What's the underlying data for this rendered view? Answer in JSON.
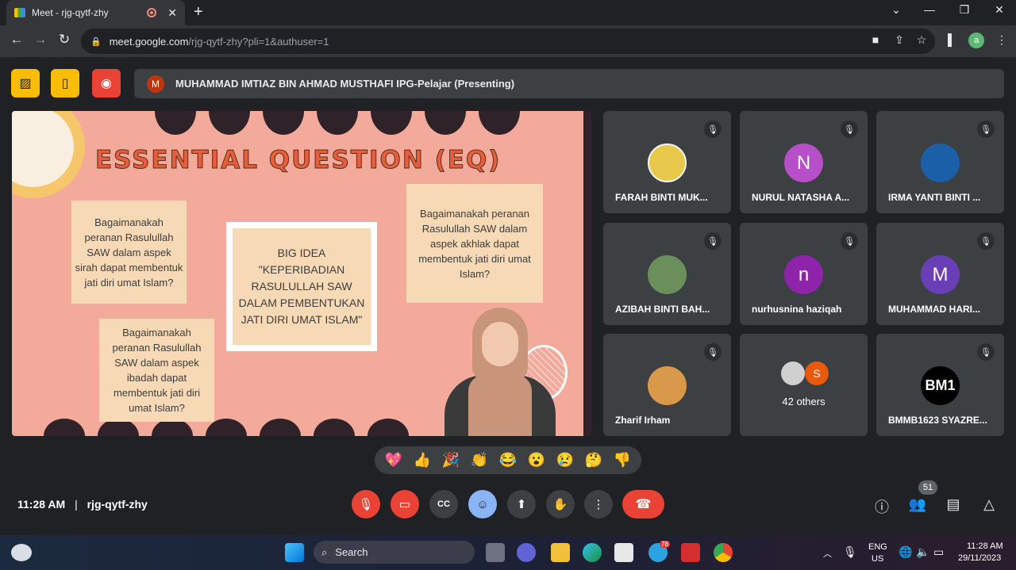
{
  "browser": {
    "tab_title": "Meet - rjg-qytf-zhy",
    "tab_close": "✕",
    "new_tab": "+",
    "url_host": "meet.google.com",
    "url_path": "/rjg-qytf-zhy?pli=1&authuser=1",
    "profile_letter": "a"
  },
  "presenter": {
    "avatar_letter": "M",
    "label": "MUHAMMAD IMTIAZ BIN AHMAD MUSTHAFI IPG-Pelajar (Presenting)",
    "avatar_color": "#bf360c"
  },
  "slide": {
    "title": "ESSENTIAL QUESTION (EQ)",
    "q1": "Bagaimanakah peranan Rasulullah SAW dalam aspek sirah dapat membentuk jati diri umat Islam?",
    "q2": "Bagaimanakah peranan Rasulullah SAW dalam aspek ibadah dapat membentuk jati diri umat Islam?",
    "q3": "Bagaimanakah peranan Rasulullah SAW dalam aspek akhlak dapat membentuk jati diri umat Islam?",
    "big_idea": "BIG IDEA \"KEPERIBADIAN RASULULLAH SAW DALAM PEMBENTUKAN JATI DIRI UMAT ISLAM\""
  },
  "participants": [
    {
      "name": "FARAH BINTI MUK...",
      "avatar": "",
      "color": "#e8c84a",
      "muted": true
    },
    {
      "name": "NURUL NATASHA A...",
      "avatar": "N",
      "color": "#b64fc8",
      "muted": true
    },
    {
      "name": "IRMA YANTI BINTI ...",
      "avatar": "",
      "color": "#1a5fa8",
      "muted": true
    },
    {
      "name": "AZIBAH BINTI BAH...",
      "avatar": "",
      "color": "#6b8f5a",
      "muted": true
    },
    {
      "name": "nurhusnina haziqah",
      "avatar": "n",
      "color": "#8e24aa",
      "muted": true
    },
    {
      "name": "MUHAMMAD HARI...",
      "avatar": "M",
      "color": "#6a3fb5",
      "muted": true
    },
    {
      "name": "Zharif Irham",
      "avatar": "",
      "color": "#d89a4a",
      "muted": true
    },
    {
      "name": "BMMB1623 SYAZRE...",
      "avatar": "BM1",
      "color": "#000000",
      "muted": true
    }
  ],
  "others": {
    "count_label": "42 others",
    "avatar_letter": "S",
    "avatar_color": "#e8590c"
  },
  "reactions": [
    "💖",
    "👍",
    "🎉",
    "👏",
    "😂",
    "😮",
    "😢",
    "🤔",
    "👎"
  ],
  "meeting": {
    "time": "11:28 AM",
    "separator": "|",
    "code": "rjg-qytf-zhy"
  },
  "people_count": "51",
  "taskbar": {
    "search": "Search",
    "lang_top": "ENG",
    "lang_bottom": "US",
    "time": "11:28 AM",
    "date": "29/11/2023",
    "telegram_badge": "78"
  },
  "colors": {
    "accent_red": "#ea4335",
    "emoji_active": "#8ab4f8"
  }
}
